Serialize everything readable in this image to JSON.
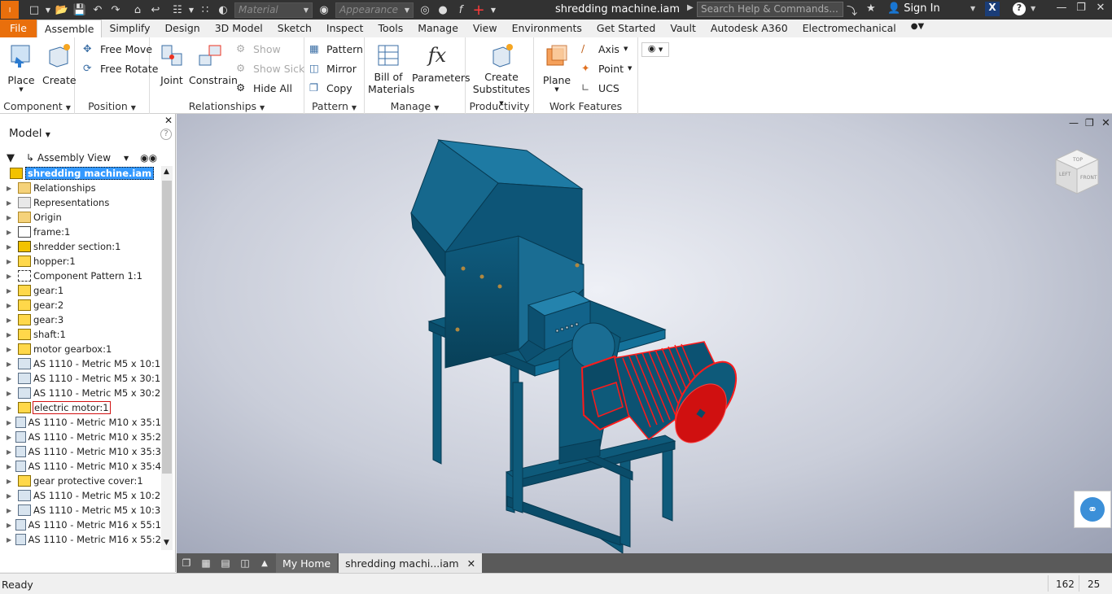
{
  "titlebar": {
    "material_placeholder": "Material",
    "appearance_placeholder": "Appearance",
    "doc_title": "shredding machine.iam",
    "search_placeholder": "Search Help & Commands...",
    "signin": "Sign In"
  },
  "tabs": [
    {
      "label": "File"
    },
    {
      "label": "Assemble"
    },
    {
      "label": "Simplify"
    },
    {
      "label": "Design"
    },
    {
      "label": "3D Model"
    },
    {
      "label": "Sketch"
    },
    {
      "label": "Inspect"
    },
    {
      "label": "Tools"
    },
    {
      "label": "Manage"
    },
    {
      "label": "View"
    },
    {
      "label": "Environments"
    },
    {
      "label": "Get Started"
    },
    {
      "label": "Vault"
    },
    {
      "label": "Autodesk A360"
    },
    {
      "label": "Electromechanical"
    }
  ],
  "ribbon": {
    "component": {
      "title": "Component",
      "place": "Place",
      "create": "Create"
    },
    "position": {
      "title": "Position",
      "free_move": "Free Move",
      "free_rotate": "Free Rotate"
    },
    "relationships": {
      "title": "Relationships",
      "joint": "Joint",
      "constrain": "Constrain",
      "show": "Show",
      "show_sick": "Show Sick",
      "hide_all": "Hide All"
    },
    "pattern": {
      "title": "Pattern",
      "pattern": "Pattern",
      "mirror": "Mirror",
      "copy": "Copy"
    },
    "manage": {
      "title": "Manage",
      "bom_1": "Bill of",
      "bom_2": "Materials",
      "parameters": "Parameters"
    },
    "productivity": {
      "title": "Productivity",
      "cs_1": "Create",
      "cs_2": "Substitutes"
    },
    "work_features": {
      "title": "Work Features",
      "plane": "Plane",
      "axis": "Axis",
      "point": "Point",
      "ucs": "UCS"
    }
  },
  "browser": {
    "title": "Model",
    "help": "?",
    "view": "Assembly View",
    "root": "shredding machine.iam",
    "items": [
      {
        "label": "Relationships",
        "icon": "folder-icon"
      },
      {
        "label": "Representations",
        "icon": "representations-icon"
      },
      {
        "label": "Origin",
        "icon": "folder-icon"
      },
      {
        "label": "frame:1",
        "icon": "weldment-icon"
      },
      {
        "label": "shredder section:1",
        "icon": "subassembly-icon"
      },
      {
        "label": "hopper:1",
        "icon": "part-icon"
      },
      {
        "label": "Component Pattern 1:1",
        "icon": "pattern-icon"
      },
      {
        "label": "gear:1",
        "icon": "part-icon"
      },
      {
        "label": "gear:2",
        "icon": "part-icon"
      },
      {
        "label": "gear:3",
        "icon": "part-icon"
      },
      {
        "label": "shaft:1",
        "icon": "part-icon"
      },
      {
        "label": "motor gearbox:1",
        "icon": "part-icon"
      },
      {
        "label": "AS 1110 - Metric M5 x 10:1",
        "icon": "bolt-icon"
      },
      {
        "label": "AS 1110 - Metric M5 x 30:1",
        "icon": "bolt-icon"
      },
      {
        "label": "AS 1110 - Metric M5 x 30:2",
        "icon": "bolt-icon"
      },
      {
        "label": "electric motor:1",
        "icon": "part-icon"
      },
      {
        "label": "AS 1110 - Metric M10 x 35:1",
        "icon": "bolt-icon"
      },
      {
        "label": "AS 1110 - Metric M10 x 35:2",
        "icon": "bolt-icon"
      },
      {
        "label": "AS 1110 - Metric M10 x 35:3",
        "icon": "bolt-icon"
      },
      {
        "label": "AS 1110 - Metric M10 x 35:4",
        "icon": "bolt-icon"
      },
      {
        "label": "gear protective cover:1",
        "icon": "part-icon"
      },
      {
        "label": "AS 1110 - Metric M5 x 10:2",
        "icon": "bolt-icon"
      },
      {
        "label": "AS 1110 - Metric M5 x 10:3",
        "icon": "bolt-icon"
      },
      {
        "label": "AS 1110 - Metric M16 x 55:1",
        "icon": "bolt-icon"
      },
      {
        "label": "AS 1110 - Metric M16 x 55:2",
        "icon": "bolt-icon"
      }
    ]
  },
  "viewcube": {
    "top": "TOP",
    "left": "LEFT",
    "front": "FRONT"
  },
  "doctabs": {
    "home": "My Home",
    "active": "shredding machi...iam"
  },
  "status": {
    "text": "Ready",
    "num1": "162",
    "num2": "25"
  },
  "colors": {
    "accent": "#e96f0c",
    "model": "#0e5a7a",
    "highlight": "#ff1a1a"
  }
}
